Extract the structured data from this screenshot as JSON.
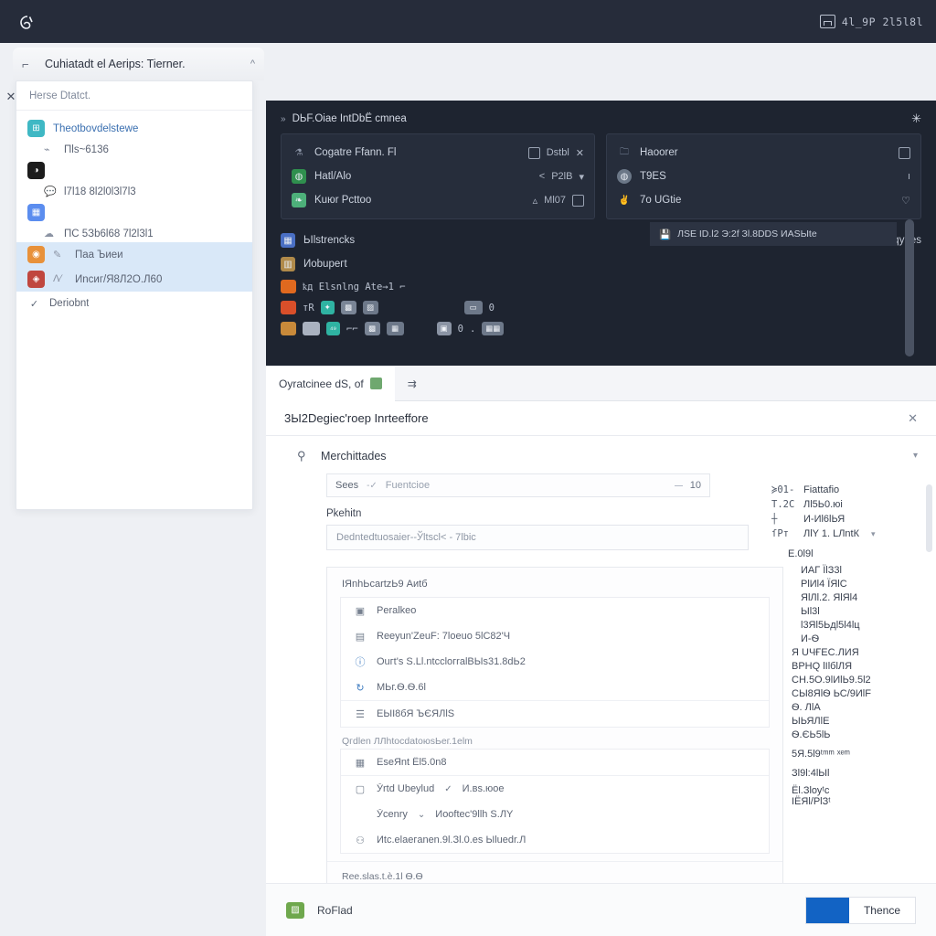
{
  "colors": {
    "topbar_bg": "#262c3a",
    "dark_panel_bg": "#1e2430",
    "accent_blue": "#1263c4",
    "selection_blue": "#d9e8f8",
    "link_blue": "#3a6fb0"
  },
  "topbar": {
    "logo_icon": "spiral-logo-icon",
    "right_icon": "window-icon",
    "right_text": "4l_9P 2l5l8l"
  },
  "tabstrip": {
    "tab_icon": "page-icon",
    "tab_title": "Cuhiatadt el Aerips: Tierner.",
    "caret": "^"
  },
  "left_panel": {
    "close_icon": "close-icon",
    "header": "Herse Dtatct.",
    "items": [
      {
        "badge_color": "#3fb8c4",
        "badge_glyph": "⊞",
        "label": "Theotbovdelstewe",
        "link": true,
        "selected": false
      },
      {
        "badge_color": "",
        "badge_glyph": "",
        "sub": true,
        "mini_icon": "chart-icon",
        "label": "Пls~6136",
        "selected": false
      },
      {
        "badge_color": "#1c1c1c",
        "badge_glyph": "◑",
        "label": "",
        "selected": false
      },
      {
        "badge_color": "",
        "badge_glyph": "",
        "sub": true,
        "mini_icon": "speech-icon",
        "label": "l7l18 8l2l0l3l7l3",
        "selected": false
      },
      {
        "badge_color": "#5b8def",
        "badge_glyph": "▦",
        "label": "",
        "selected": false
      },
      {
        "badge_color": "",
        "badge_glyph": "",
        "sub": true,
        "mini_icon": "cloud-icon",
        "label": "ПС 5Зb6l68 7l2l3l1",
        "selected": false
      },
      {
        "badge_color": "#e8913a",
        "badge_glyph": "◉",
        "sub2": true,
        "mini_icon": "pencil-icon",
        "label": "Паа Ъиеи",
        "selected": true
      },
      {
        "badge_color": "#c0473f",
        "badge_glyph": "◈",
        "sub2": true,
        "mini_icon": "tag-icon",
        "label": "Иnсиг/Я8Л2О.Л60",
        "selected": true
      },
      {
        "check": true,
        "mini_icon": "check-icon",
        "label": "Deriobnt",
        "selected": false
      }
    ]
  },
  "dark_panel": {
    "breadcrumb_chev": "»",
    "title": "DЬF.Oiae IntDbЁ cmnea",
    "star_icon": "star-icon",
    "left_card": [
      {
        "icon": "flask-icon",
        "icon_color": "#8d96a8",
        "label": "Cogatre Ffann. Fl",
        "actions": [
          {
            "type": "sq",
            "name": "panel-icon"
          },
          {
            "type": "text",
            "label": "Dstbl"
          },
          {
            "type": "text",
            "label": "✕"
          }
        ]
      },
      {
        "icon": "globe-icon",
        "icon_color": "#2f8f4e",
        "label": "Hatl/Alo",
        "actions": [
          {
            "type": "text",
            "label": "<"
          },
          {
            "type": "text",
            "label": "P2lB"
          },
          {
            "type": "text",
            "label": "▾"
          }
        ]
      },
      {
        "icon": "leaf-icon",
        "icon_color": "#4db07a",
        "label": "Kuюr Pcttoo",
        "actions": [
          {
            "type": "text",
            "label": "▵"
          },
          {
            "type": "text",
            "label": "Ml07"
          },
          {
            "type": "sq",
            "name": "copy-icon"
          }
        ]
      }
    ],
    "right_card": [
      {
        "icon": "folder-icon",
        "icon_color": "#7f8ca0",
        "label": "Haoorer",
        "action": "⊟"
      },
      {
        "icon": "globe-icon",
        "icon_color": "#9aa3b4",
        "label": "T9ЕS",
        "action": "ı"
      },
      {
        "icon": "hand-icon",
        "icon_color": "#8d96a8",
        "label": "7o UGtie",
        "action": "♡"
      }
    ],
    "lower_rows": [
      {
        "icon": "grid-icon",
        "icon_color": "#4a6fc4",
        "label": "ЬIlstrencks",
        "trailing": "Sqydes"
      },
      {
        "icon": "box-icon",
        "icon_color": "#b08a4a",
        "label": "Иobupeгt",
        "trailing": ""
      }
    ],
    "chip_rows": [
      {
        "lead_color": "#e0691f",
        "chips": [],
        "text": "ҟд Elsnlng Ate→1  ⌐"
      },
      {
        "lead_color": "#d94f2a",
        "chips": [
          {
            "color": "transparent",
            "glyph": "тR"
          },
          {
            "color": "#2fb3a2",
            "glyph": "✦"
          },
          {
            "color": "#7a8596",
            "glyph": "▩"
          },
          {
            "color": "#6d7889",
            "glyph": "▨"
          }
        ],
        "tail_chips": [
          {
            "color": "#6d7889",
            "glyph": "▭"
          },
          {
            "color": "transparent",
            "glyph": "0"
          }
        ]
      },
      {
        "lead_color": "#c98a3a",
        "chips": [
          {
            "color": "#aab2c0",
            "glyph": "▬"
          },
          {
            "color": "#2fb3a2",
            "glyph": "⁴⁹"
          },
          {
            "color": "transparent",
            "glyph": "⌐⌐"
          },
          {
            "color": "#7a8596",
            "glyph": "▩"
          },
          {
            "color": "#6d7889",
            "glyph": "▦"
          }
        ],
        "tail_chips": [
          {
            "color": "#8b94a4",
            "glyph": "▣"
          },
          {
            "color": "transparent",
            "glyph": "0"
          },
          {
            "color": "transparent",
            "glyph": "."
          },
          {
            "color": "#6d7889",
            "glyph": "▦▦"
          }
        ]
      }
    ],
    "toast": {
      "icon": "save-icon",
      "text": "ЛSЕ ID.l2  Э:2f  Зl.8DDS ИАSЫte"
    },
    "scrollbar": "vertical-scrollbar"
  },
  "content_tabs": {
    "active": {
      "label": "Oyratcinee dS, of",
      "icon": "grid-icon",
      "icon_color": "#6fa86f"
    },
    "arrow": "⇉"
  },
  "form": {
    "header": {
      "title": "3Ы2Degiec'roep Inrteeffore",
      "close": "✕"
    },
    "section": {
      "icon": "pointer-icon",
      "title": "Merchittades",
      "chevron": "▾"
    },
    "searchbar": {
      "label": "Sees",
      "divider": "-✓",
      "placeholder": "Fuentcioe",
      "dash": "—",
      "count": "10"
    },
    "field_label": "Pkehitn",
    "field_value": "Dedntedtuosaier--Ўltscl< - 7lbic",
    "subcard": {
      "title": "IЯnhЬcartzЬ9 Aиtб",
      "rows": [
        {
          "icon": "image-icon",
          "icon_color": "#7b8594",
          "label": "Peralkeo",
          "bordered": false
        },
        {
          "icon": "calendar-icon",
          "icon_color": "#7b8594",
          "label": "Reeyun'ZeuF:  7loeuo 5lC82'Ч",
          "bordered": false
        },
        {
          "icon": "info-icon",
          "icon_color": "#3f7cc0",
          "label": "Ouгt'ѕ Ѕ.Ll.ntсcloгrаlВЫs31.8dЬ2",
          "bordered": false
        },
        {
          "icon": "refresh-icon",
          "icon_color": "#3f7cc0",
          "label": "МЬг.Ѳ.Ѳ.6l",
          "bordered": false
        },
        {
          "icon": "list-icon",
          "icon_color": "#7b8594",
          "label": "ЕЫI8бЯ  ЪЄЯЛlS",
          "bordered": true
        }
      ],
      "note": "Qгdlen ЛЛhtоcdаtоюsЬeг.1elm",
      "rows2": [
        {
          "icon": "table-icon",
          "icon_color": "#6c7687",
          "label": "ЕsеЯnt Ёl5.0n8",
          "bordered": false
        },
        {
          "icon": "square-icon",
          "icon_color": "#8b94a3",
          "label": "Ўrtd Ubeylud",
          "check": "✓",
          "label2": "И.вs.юoe",
          "bordered": true
        },
        {
          "icon": "",
          "icon_color": "",
          "label": "Ўcenry",
          "check": "⌄",
          "label2": "Иoofteс'9llh Ѕ.ЛY",
          "bordered": false
        },
        {
          "icon": "user-icon",
          "icon_color": "#7b8594",
          "label": "Иtс.еlаeгanen.9l.Зl.0.еs Ыluеdr.Л",
          "bordered": false
        }
      ],
      "footer": "Ree.slаs.t.ѐ.1l Ѳ.Ѳ"
    },
    "side": {
      "rows": [
        {
          "key": "≽01-",
          "value": "Fiattafio",
          "chevron": ""
        },
        {
          "key": "T.2C",
          "value": "Лl5Ь0.юi",
          "chevron": ""
        },
        {
          "key": "┼",
          "value": "И-Иl6lЬЯ",
          "chevron": ""
        },
        {
          "key": "ſPт",
          "value": "ЛlY  1. LЛntК",
          "chevron": "▾"
        }
      ],
      "group_label": "Е.0l9l",
      "items": [
        "ИАГ ЇlЗ3l",
        "PlИl4 ЇЯlС",
        "ЯlЛl.2. ЯlЯl4",
        "Ыl3l",
        "l3Яl5Ьдl5l4lц",
        "И-Ѳ",
        "Я  UЧҒЕС.ЛИЯ",
        "ВРНQ  lӀlбlЛЯ",
        "CН.5О.9lИlЬ9.5l2",
        "СЫ8ЯlѲ  ЬС/9ИlF",
        "Ѳ. ЛlА",
        "ЫЬЯЛlЕ",
        "Ѳ.ЄЬ5lЬ",
        "5Я.5l9ᵗᵐᵐ ˣᵉᵐ",
        "Зl9l:4lЫl",
        "Ёl.Зlоуᵗс",
        "ІЁЯl/РlЗᵗ"
      ],
      "scrollbar": "vertical-scrollbar"
    },
    "footer": {
      "icon": "chart-icon",
      "icon_color": "#6fa84d",
      "label": "RoFlad",
      "button_label": "Thence"
    }
  }
}
